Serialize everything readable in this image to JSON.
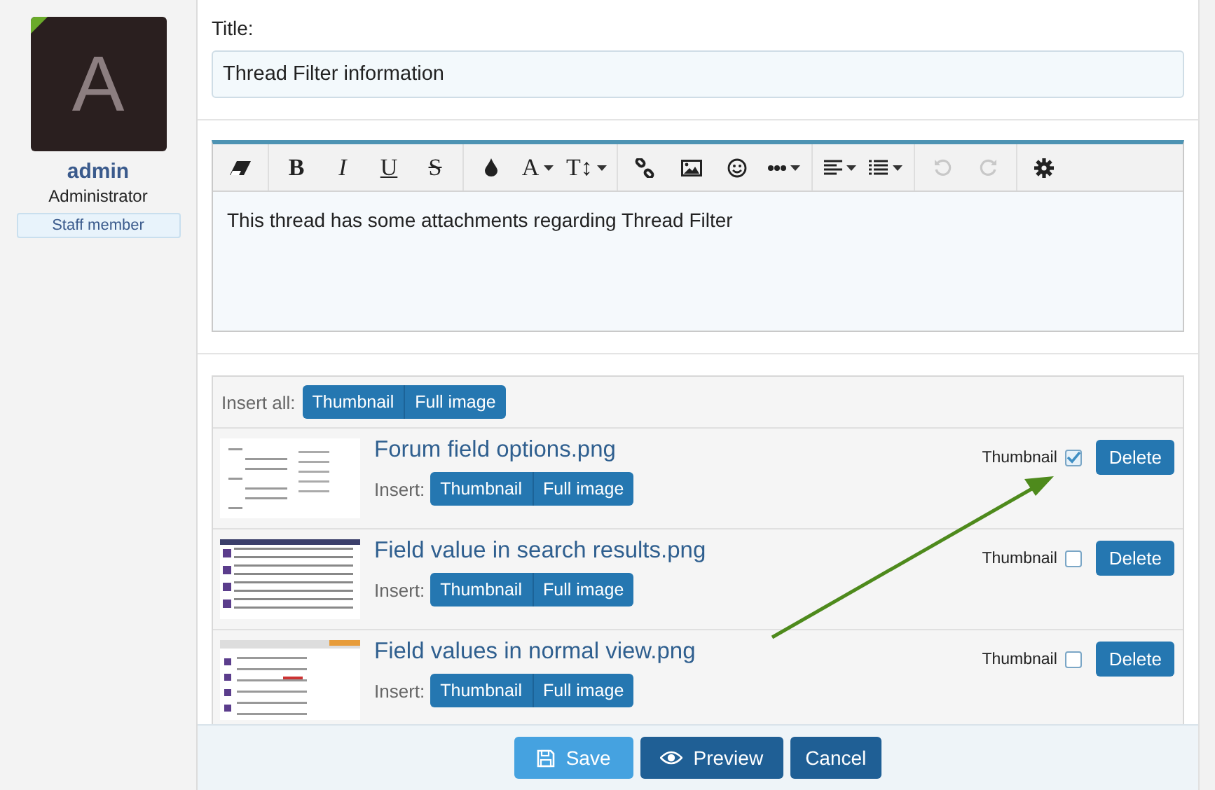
{
  "user": {
    "avatar_letter": "A",
    "name": "admin",
    "title": "Administrator",
    "badge": "Staff member"
  },
  "title_field": {
    "label": "Title:",
    "value": "Thread Filter information"
  },
  "toolbar": [
    [
      {
        "kind": "eraser"
      }
    ],
    [
      {
        "kind": "bold",
        "label": "B"
      },
      {
        "kind": "italic",
        "label": "I"
      },
      {
        "kind": "underline",
        "label": "U"
      },
      {
        "kind": "strike",
        "label": "S"
      }
    ],
    [
      {
        "kind": "drop"
      },
      {
        "kind": "text",
        "label": "A",
        "dropdown": true
      },
      {
        "kind": "text",
        "label": "T↕",
        "dropdown": true
      }
    ],
    [
      {
        "kind": "link"
      },
      {
        "kind": "image"
      },
      {
        "kind": "smiley"
      },
      {
        "kind": "more",
        "dropdown": true
      }
    ],
    [
      {
        "kind": "align",
        "dropdown": true
      },
      {
        "kind": "list",
        "dropdown": true
      }
    ],
    [
      {
        "kind": "undo",
        "disabled": true
      },
      {
        "kind": "redo",
        "disabled": true
      }
    ],
    [
      {
        "kind": "gear"
      }
    ]
  ],
  "editor": {
    "text": "This thread has some attachments regarding Thread Filter"
  },
  "attachments": {
    "insert_all_label": "Insert all:",
    "insert_all_buttons": [
      "Thumbnail",
      "Full image"
    ],
    "items": [
      {
        "name": "Forum field options.png",
        "insert_label": "Insert:",
        "buttons": [
          "Thumbnail",
          "Full image"
        ],
        "thumbnail_label": "Thumbnail",
        "thumbnail_checked": true,
        "delete": "Delete"
      },
      {
        "name": "Field value in search results.png",
        "insert_label": "Insert:",
        "buttons": [
          "Thumbnail",
          "Full image"
        ],
        "thumbnail_label": "Thumbnail",
        "thumbnail_checked": false,
        "delete": "Delete"
      },
      {
        "name": "Field values in normal view.png",
        "insert_label": "Insert:",
        "buttons": [
          "Thumbnail",
          "Full image"
        ],
        "thumbnail_label": "Thumbnail",
        "thumbnail_checked": false,
        "delete": "Delete"
      }
    ]
  },
  "footer_buttons": [
    {
      "kind": "save",
      "label": "Save"
    },
    {
      "kind": "preview",
      "label": "Preview"
    },
    {
      "kind": "cancel",
      "label": "Cancel"
    }
  ]
}
